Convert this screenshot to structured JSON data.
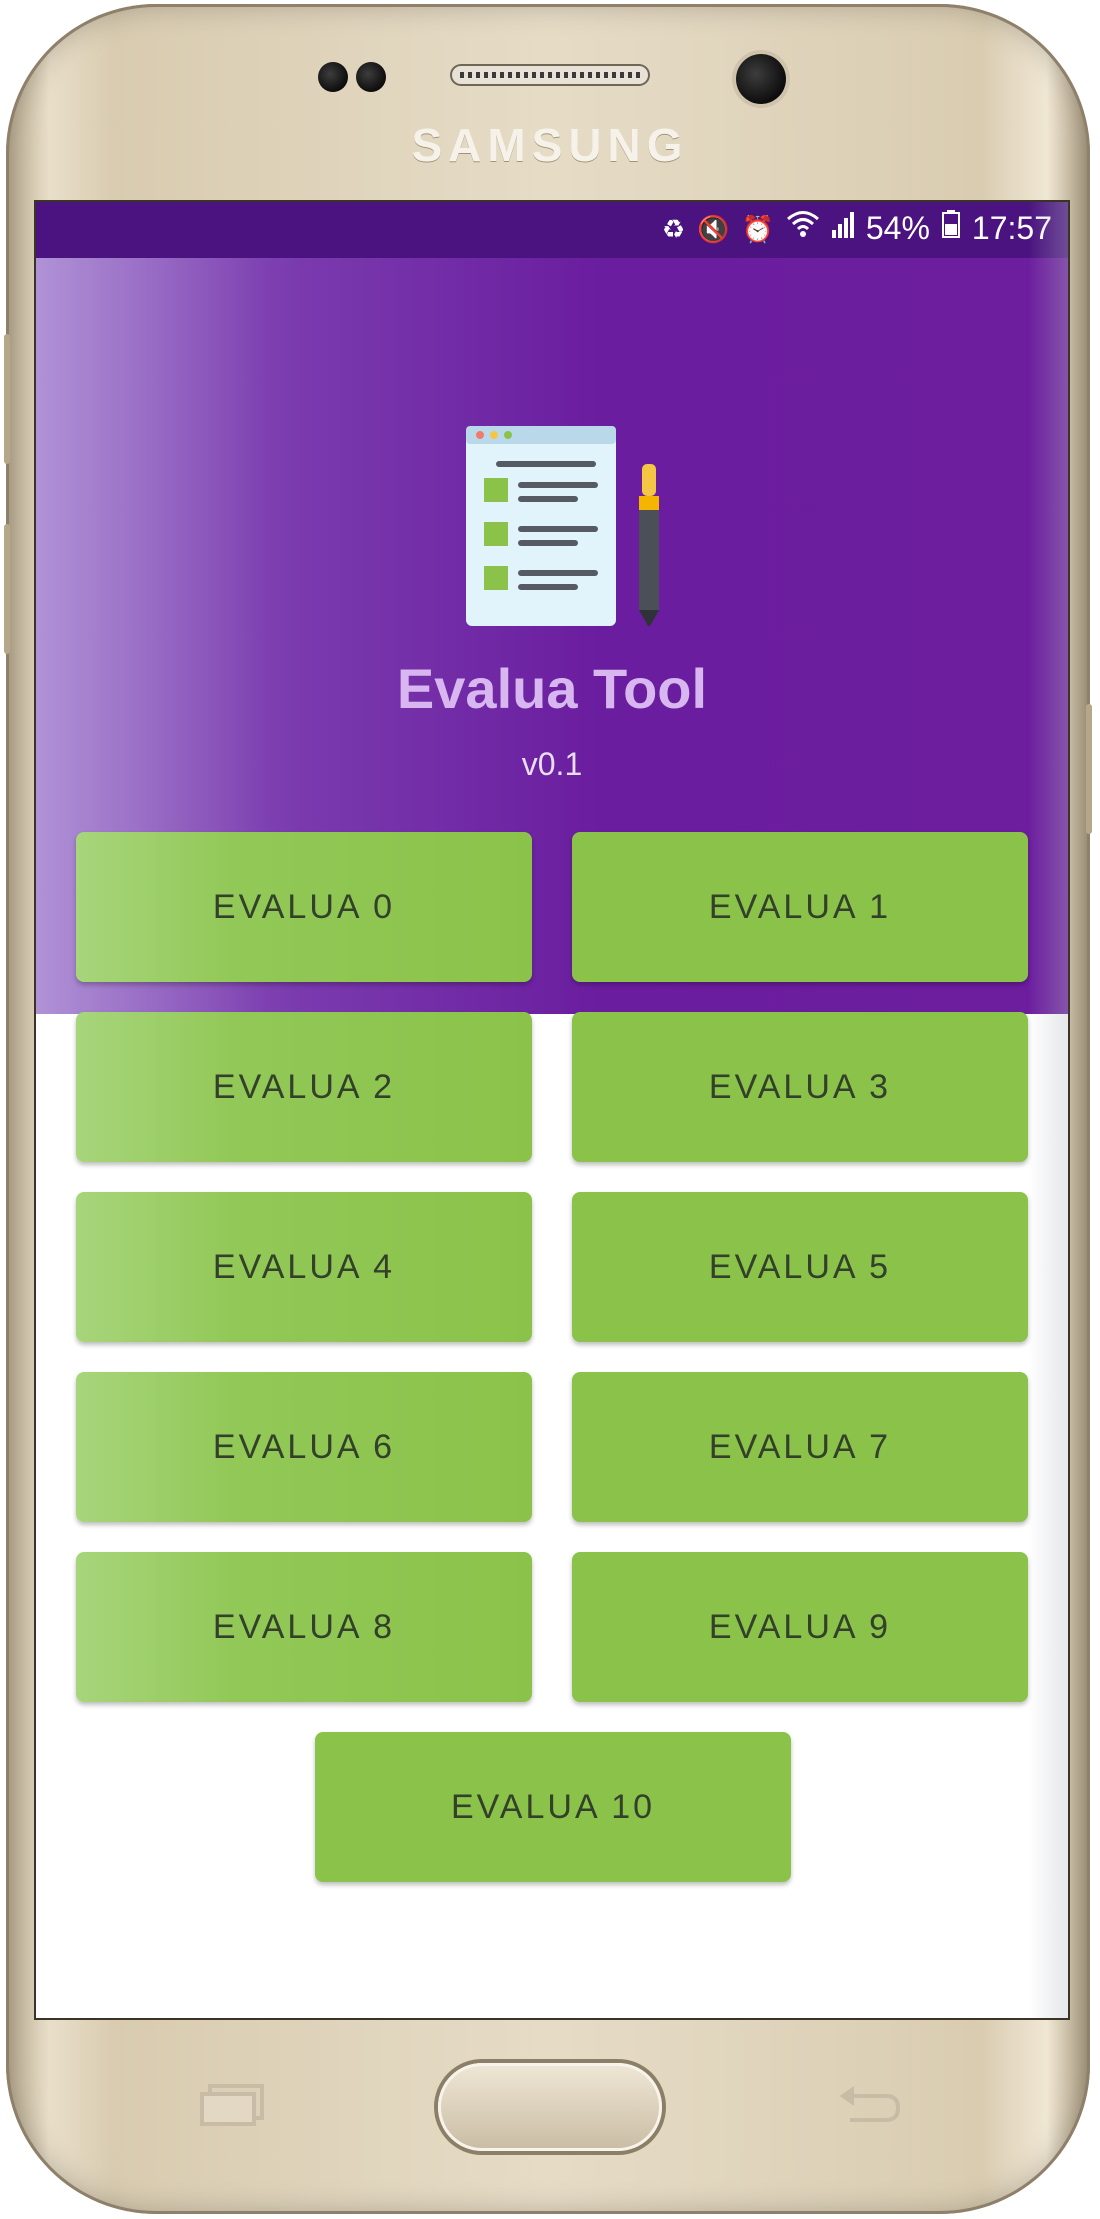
{
  "device": {
    "brand": "SAMSUNG"
  },
  "status_bar": {
    "battery": "54%",
    "time": "17:57",
    "icons": [
      "sync-icon",
      "mute-icon",
      "alarm-icon",
      "wifi-icon",
      "signal-icon",
      "battery-icon"
    ]
  },
  "header": {
    "app_title": "Evalua Tool",
    "version": "v0.1",
    "logo_icon": "checklist-pen-icon"
  },
  "buttons": [
    {
      "label": "EVALUA 0"
    },
    {
      "label": "EVALUA 1"
    },
    {
      "label": "EVALUA 2"
    },
    {
      "label": "EVALUA 3"
    },
    {
      "label": "EVALUA 4"
    },
    {
      "label": "EVALUA 5"
    },
    {
      "label": "EVALUA 6"
    },
    {
      "label": "EVALUA 7"
    },
    {
      "label": "EVALUA 8"
    },
    {
      "label": "EVALUA 9"
    },
    {
      "label": "EVALUA 10"
    }
  ],
  "colors": {
    "header_purple": "#6a1d9f",
    "status_bar": "#4a1380",
    "button_green": "#8bc34a",
    "title_lilac": "#d8b6ef"
  },
  "nav_keys": [
    "recent-apps-icon",
    "home-button",
    "back-icon"
  ]
}
